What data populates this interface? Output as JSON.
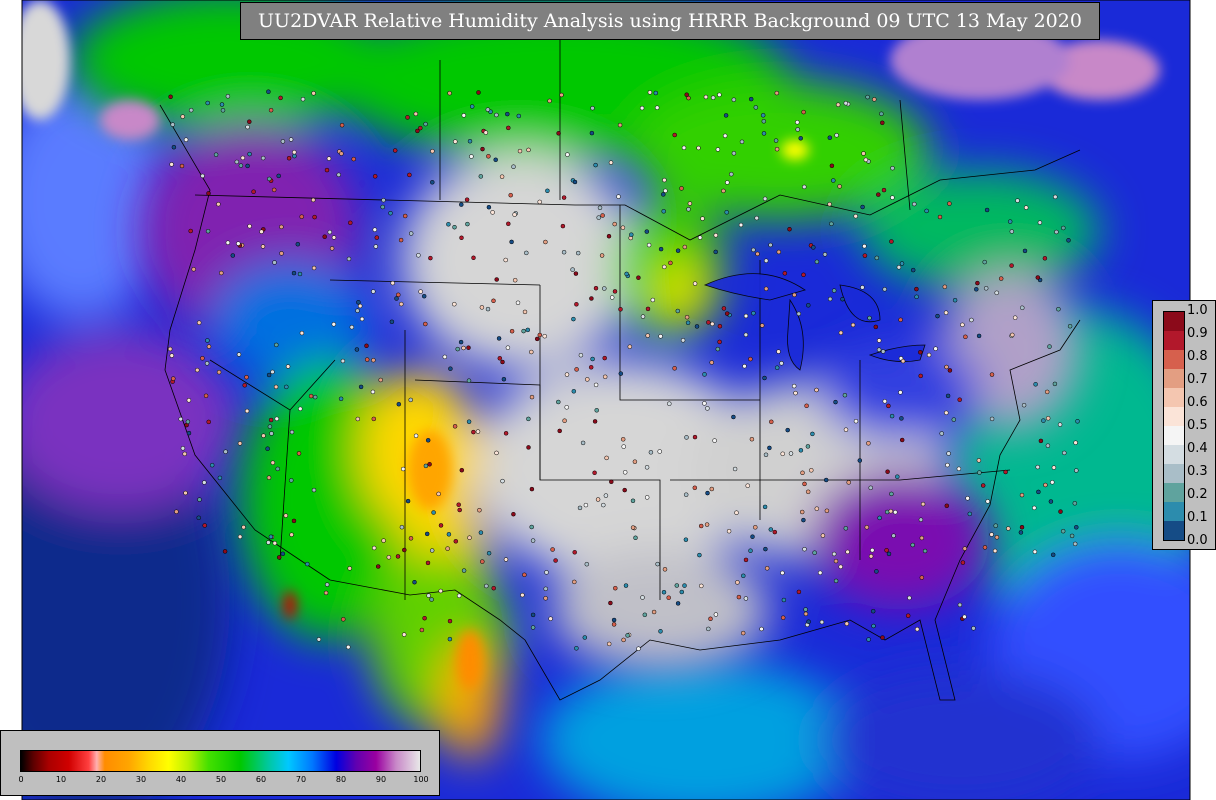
{
  "title": "UU2DVAR Relative Humidity Analysis using HRRR Background 09 UTC 13 May 2020",
  "map": {
    "type": "relative-humidity-analysis",
    "projection": "lambert-conformal",
    "region": "CONUS",
    "background_fill": "#d0d0d0"
  },
  "rh_colorbar": {
    "ticks": [
      "0",
      "10",
      "20",
      "30",
      "40",
      "50",
      "60",
      "70",
      "80",
      "90",
      "100"
    ],
    "stops": [
      {
        "v": 0,
        "c": "#000000"
      },
      {
        "v": 3,
        "c": "#5a0000"
      },
      {
        "v": 7,
        "c": "#aa0000"
      },
      {
        "v": 12,
        "c": "#d00000"
      },
      {
        "v": 17,
        "c": "#ff4040"
      },
      {
        "v": 19,
        "c": "#ffb0b0"
      },
      {
        "v": 21,
        "c": "#ff8c00"
      },
      {
        "v": 27,
        "c": "#ffa500"
      },
      {
        "v": 32,
        "c": "#ffd700"
      },
      {
        "v": 37,
        "c": "#ffff00"
      },
      {
        "v": 42,
        "c": "#b8f000"
      },
      {
        "v": 47,
        "c": "#44e000"
      },
      {
        "v": 55,
        "c": "#00c800"
      },
      {
        "v": 62,
        "c": "#00c8a0"
      },
      {
        "v": 67,
        "c": "#00c8ff"
      },
      {
        "v": 73,
        "c": "#0078ff"
      },
      {
        "v": 79,
        "c": "#0000e0"
      },
      {
        "v": 84,
        "c": "#6000b0"
      },
      {
        "v": 89,
        "c": "#9a00a0"
      },
      {
        "v": 94,
        "c": "#c888c8"
      },
      {
        "v": 100,
        "c": "#e8e8e8"
      }
    ]
  },
  "obs_colorbar": {
    "ticks": [
      "1.0",
      "0.9",
      "0.8",
      "0.7",
      "0.6",
      "0.5",
      "0.4",
      "0.3",
      "0.2",
      "0.1",
      "0.0"
    ],
    "colors": [
      "#8b0a1a",
      "#b2182b",
      "#d6604d",
      "#e39e82",
      "#f4c6b0",
      "#fbe4d8",
      "#f5f5f5",
      "#d4dde2",
      "#a9bec8",
      "#5fa39e",
      "#2c8cad",
      "#154c86"
    ]
  },
  "palette": {
    "land_dry": "#ffa500",
    "land_moist": "#00c800",
    "saturated": "#e0e0e0",
    "ocean_moist": "#0000e0",
    "purple": "#7a00a8"
  }
}
